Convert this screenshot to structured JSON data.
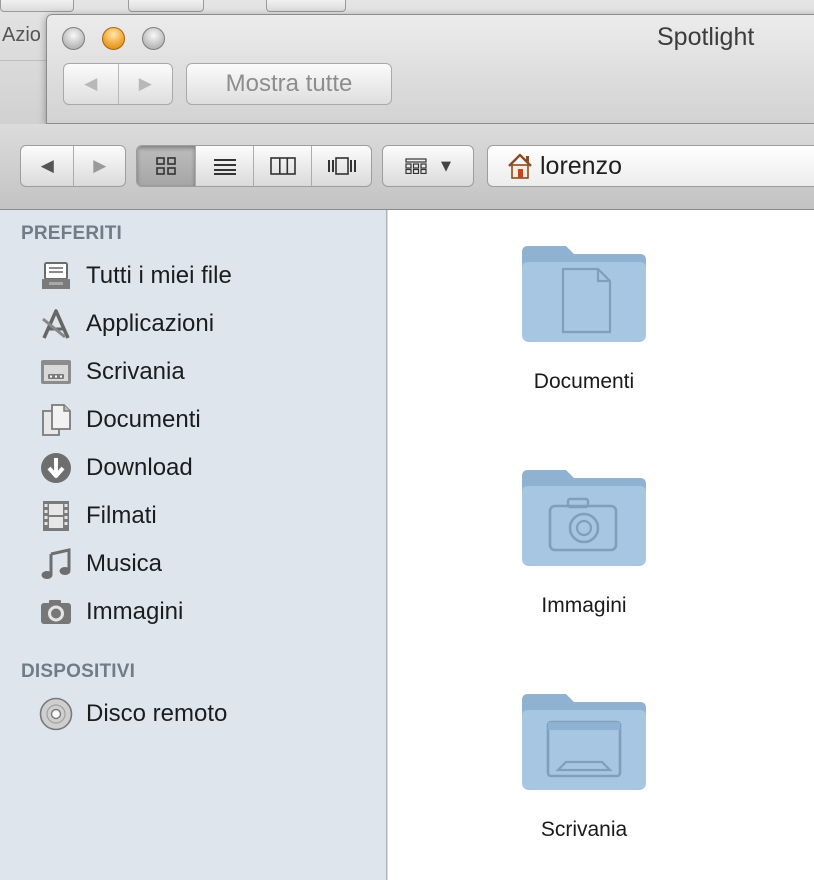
{
  "background_window": {
    "toolbar_label": "Azio"
  },
  "spotlight_window": {
    "title": "Spotlight",
    "back_glyph": "◀",
    "forward_glyph": "▶",
    "show_all_label": "Mostra tutte"
  },
  "finder_toolbar": {
    "back_glyph": "◀",
    "forward_glyph": "▶",
    "view_modes": [
      "icon-view",
      "list-view",
      "column-view",
      "coverflow-view"
    ],
    "active_view": "icon-view",
    "arrange_dropdown_glyph": "▼",
    "path_label": "lorenzo"
  },
  "sidebar": {
    "favorites_header": "PREFERITI",
    "favorites": [
      {
        "label": "Tutti i miei file",
        "icon": "all-files-icon"
      },
      {
        "label": "Applicazioni",
        "icon": "applications-icon"
      },
      {
        "label": "Scrivania",
        "icon": "desktop-icon"
      },
      {
        "label": "Documenti",
        "icon": "documents-icon"
      },
      {
        "label": "Download",
        "icon": "download-icon"
      },
      {
        "label": "Filmati",
        "icon": "film-icon"
      },
      {
        "label": "Musica",
        "icon": "music-note-icon"
      },
      {
        "label": "Immagini",
        "icon": "camera-icon"
      }
    ],
    "devices_header": "DISPOSITIVI",
    "devices": [
      {
        "label": "Disco remoto",
        "icon": "disc-icon"
      }
    ]
  },
  "content": {
    "items": [
      {
        "name": "Documenti",
        "icon": "documents-folder-icon"
      },
      {
        "name": "Immagini",
        "icon": "pictures-folder-icon"
      },
      {
        "name": "Scrivania",
        "icon": "desktop-folder-icon"
      }
    ]
  },
  "colors": {
    "sidebar_bg": "#dfe5ec",
    "section_header": "#6f7c89",
    "folder_blue": "#9cbcd7",
    "minimize_orange": "#f3a93a"
  }
}
